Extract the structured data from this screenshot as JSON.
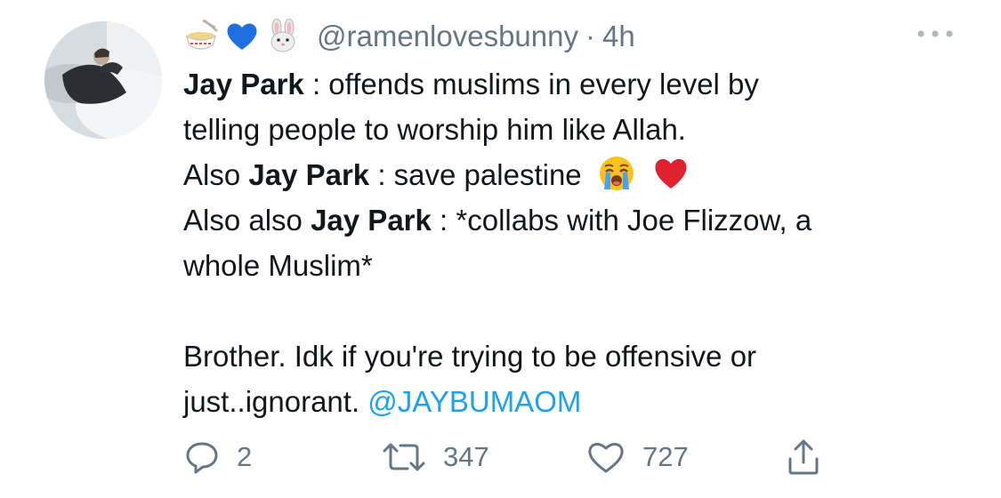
{
  "tweet": {
    "author": {
      "handle": "@ramenlovesbunny",
      "name_emojis": [
        "ramen-emoji",
        "blue-heart-emoji",
        "rabbit-face-emoji"
      ]
    },
    "separator": "·",
    "time": "4h",
    "body": {
      "line1": {
        "bold": "Jay Park",
        "rest": " : offends muslims in every level by"
      },
      "line2": {
        "text": "telling people to worship him like Allah."
      },
      "line3": {
        "pre": "Also ",
        "bold": "Jay Park",
        "rest": " : save palestine",
        "emojis": [
          "loudly-crying-face-emoji",
          "red-heart-emoji"
        ]
      },
      "line4": {
        "pre": "Also also ",
        "bold": "Jay Park",
        "rest": " : *collabs with Joe Flizzow, a"
      },
      "line5": {
        "text": "whole Muslim*"
      },
      "line6": {
        "text": "Brother. Idk if you're trying to be offensive or"
      },
      "line7": {
        "pre": "just..ignorant. ",
        "mention": "@JAYBUMAOM"
      }
    },
    "actions": {
      "reply_count": "2",
      "retweet_count": "347",
      "like_count": "727"
    },
    "colors": {
      "text": "#14171a",
      "secondary": "#657786",
      "link": "#1da1f2"
    }
  }
}
